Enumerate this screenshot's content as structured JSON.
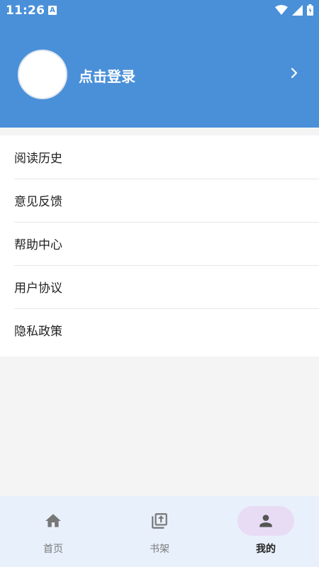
{
  "status_bar": {
    "time": "11:26",
    "notification_icon_letter": "A"
  },
  "header": {
    "login_label": "点击登录"
  },
  "menu": {
    "items": [
      {
        "label": "阅读历史"
      },
      {
        "label": "意见反馈"
      },
      {
        "label": "帮助中心"
      },
      {
        "label": "用户协议"
      },
      {
        "label": "隐私政策"
      }
    ]
  },
  "tabbar": {
    "tabs": [
      {
        "label": "首页",
        "icon": "home-icon",
        "active": false
      },
      {
        "label": "书架",
        "icon": "bookshelf-icon",
        "active": false
      },
      {
        "label": "我的",
        "icon": "person-icon",
        "active": true
      }
    ]
  },
  "colors": {
    "header_bg": "#4a90d9",
    "tabbar_bg": "#e8f0fb",
    "active_tab_pill": "#e8dcf5"
  }
}
